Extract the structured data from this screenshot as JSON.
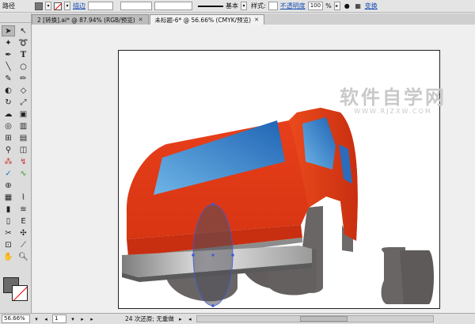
{
  "control_bar": {
    "object_type": "路径",
    "stroke_label": "描边",
    "stroke_style": "基本",
    "style_label": "样式:",
    "opacity_label": "不透明度",
    "opacity_value": "100",
    "opacity_unit": "%",
    "transform_label": "变换"
  },
  "tabs": [
    {
      "label": "2 [转换].ai* @ 87.94% (RGB/预览)",
      "active": false
    },
    {
      "label": "未标题-6* @ 56.66% (CMYK/预览)",
      "active": true
    }
  ],
  "tools": [
    "selection-tool",
    "direct-selection-tool",
    "magic-wand-tool",
    "lasso-tool",
    "pen-tool",
    "type-tool",
    "line-segment-tool",
    "ellipse-tool",
    "paintbrush-tool",
    "pencil-tool",
    "blob-brush-tool",
    "eraser-tool",
    "rotate-tool",
    "scale-tool",
    "warp-tool",
    "free-transform-tool",
    "shape-builder-tool",
    "perspective-grid-tool",
    "mesh-tool",
    "gradient-tool",
    "eyedropper-tool",
    "blend-tool",
    "symbol-sprayer-tool",
    "column-graph-tool",
    "artboard-tool",
    "slice-tool",
    "hand-tool",
    "zoom-tool"
  ],
  "watermark": {
    "big": "软件自学网",
    "small": "WWW.RJZXW.COM"
  },
  "status": {
    "zoom": "56.66%",
    "page": "1",
    "message": "24 次还原; 无重做"
  },
  "colors": {
    "van_top": "#e8401c",
    "van_bottom": "#d83a12",
    "window": "#2f86c8",
    "grey": "#6a6565",
    "bumper_light": "#d8d8d8",
    "bumper_dark": "#8a8a8a",
    "selection": "#3b5bdb"
  }
}
